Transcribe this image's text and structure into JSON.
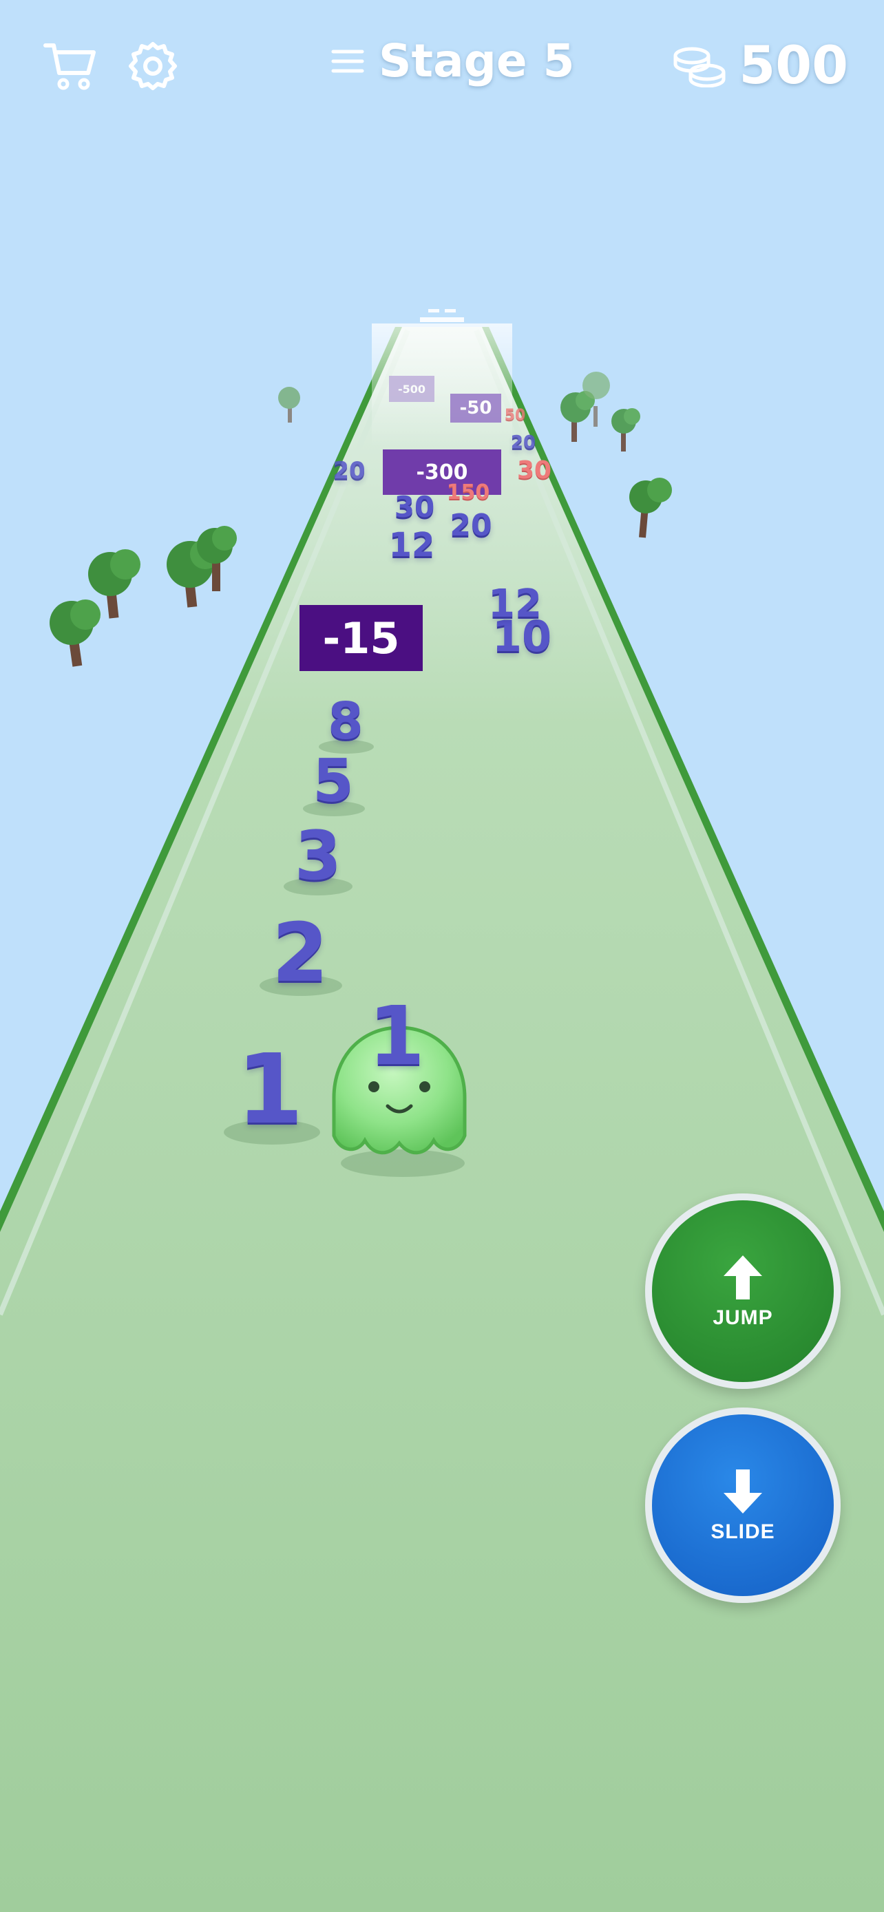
{
  "hud": {
    "stage_label": "Stage 5",
    "coins": "500",
    "icons": {
      "cart": "shopping-cart-icon",
      "settings": "gear-icon",
      "menu": "menu-icon",
      "coins": "coin-stack-icon"
    }
  },
  "player": {
    "value": "1"
  },
  "track_numbers": [
    {
      "value": "1",
      "color": "blue"
    },
    {
      "value": "2",
      "color": "blue"
    },
    {
      "value": "3",
      "color": "blue"
    },
    {
      "value": "5",
      "color": "blue"
    },
    {
      "value": "8",
      "color": "blue"
    },
    {
      "value": "10",
      "color": "blue"
    },
    {
      "value": "12",
      "color": "blue"
    },
    {
      "value": "12",
      "color": "blue"
    },
    {
      "value": "20",
      "color": "blue"
    },
    {
      "value": "30",
      "color": "blue"
    },
    {
      "value": "150",
      "color": "red"
    },
    {
      "value": "30",
      "color": "red"
    },
    {
      "value": "20",
      "color": "blue"
    },
    {
      "value": "20",
      "color": "blue"
    },
    {
      "value": "50",
      "color": "red"
    }
  ],
  "obstacles": [
    {
      "value": "-15"
    },
    {
      "value": "-300"
    },
    {
      "value": "-50"
    },
    {
      "value": "-500"
    }
  ],
  "controls": {
    "jump_label": "JUMP",
    "slide_label": "SLIDE"
  },
  "colors": {
    "sky": "#bfe0fb",
    "road": "#a2cf9f",
    "road_edge": "#3f9a3b",
    "obstacle": "#4b0f82",
    "number_blue": "#5656c8",
    "number_red": "#ee7a7a",
    "jump_button": "#2e8b34",
    "slide_button": "#1a6fd6",
    "player": "#8ee48a"
  }
}
